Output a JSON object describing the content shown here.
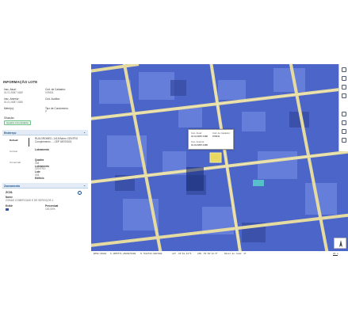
{
  "panel": {
    "title": "INFORMAÇÃO LOTE",
    "fields": [
      {
        "label": "Insc. Atual:",
        "value": "01.01.0087.0180"
      },
      {
        "label": "Cód. de Cadastro:",
        "value": "076531"
      },
      {
        "label": "Insc. Anterior:",
        "value": "01.01.0087.0180"
      },
      {
        "label": "Cód. Auxiliar:",
        "value": ""
      },
      {
        "label": "Metrô(s):",
        "value": ""
      },
      {
        "label": "Tipo de Condomínio:",
        "value": "P"
      },
      {
        "label": "Situação:",
        "value": ""
      }
    ],
    "situacao_badge": "Quadra Consolidada",
    "endereco": {
      "section_title": "Endereço",
      "tabs": [
        "Default",
        "Correio",
        "Comercial"
      ],
      "address": "RUA DROMED, 1418 Bairro CENTRO Complemento - - CEP 68700023",
      "quadra_label": "Quadra",
      "quadra_value": "048",
      "loteamento_label": "Loteamento",
      "loteamento_value": "CENTRO",
      "lote_label": "Lote",
      "lote_value": "003",
      "edificio_label": "Edifício",
      "edificio_value": ""
    },
    "zoneamento": {
      "section_title": "Zoneamento",
      "code": "ZC01",
      "nome_label": "Nome",
      "nome_value": "ZONAS COMERCIAIS E DE SERVIÇOS 1",
      "exibir_label": "Exibir",
      "percentual_label": "Percentual",
      "percentual_value": "100,00%"
    }
  },
  "popup": {
    "insc_atual_label": "Insc. Atual:",
    "insc_atual_value": "01.01.0087.0180",
    "cod_cadastro_label": "Cód. de Cadastro:",
    "cod_cadastro_value": "076531",
    "insc_anterior_label": "Insc. Anterior:",
    "insc_anterior_value": "01.01.0087.0180"
  },
  "statusbar": {
    "srs": "EPSG:31982",
    "coords": "S 4955771.2686074400",
    "coords2": "N 7412743.9867000",
    "lat": "LAT -13'18.44\"S",
    "lon": "LON -51'38'12.5\"",
    "zoom": "Nível de zoom: 17",
    "scale": "20 m"
  },
  "colors": {
    "map_blue": "#4b66c8",
    "road": "#e5dba1",
    "accent": "#1b4f8a"
  }
}
